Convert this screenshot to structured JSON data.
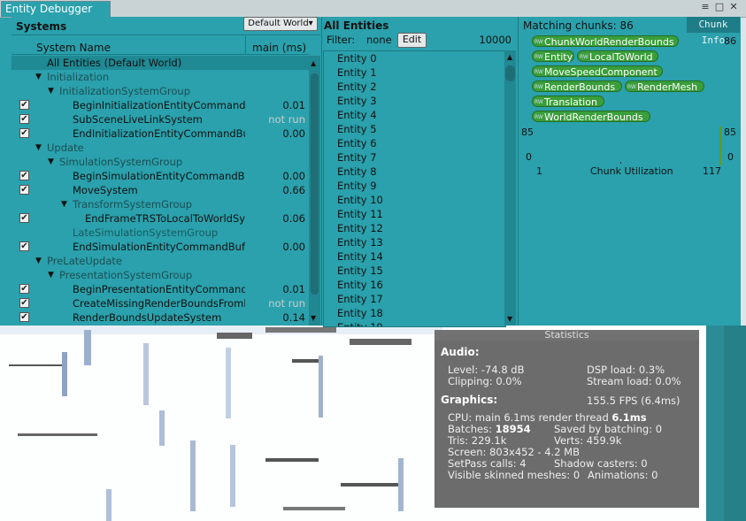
{
  "window": {
    "tab_title": "Entity Debugger"
  },
  "systems": {
    "title": "Systems",
    "world_button": "Default World▾",
    "col_name": "System Name",
    "col_main": "main (ms)",
    "rows": [
      {
        "name": "All Entities (Default World)",
        "indent": 40,
        "check": false,
        "tri": "",
        "val": "",
        "sel": true
      },
      {
        "name": "Initialization",
        "indent": 40,
        "check": false,
        "tri": "▼",
        "val": "",
        "grp": true
      },
      {
        "name": "InitializationSystemGroup",
        "indent": 54,
        "check": false,
        "tri": "▼",
        "val": "",
        "grp": true
      },
      {
        "name": "BeginInitializationEntityCommandB",
        "indent": 69,
        "check": true,
        "tri": "",
        "val": "0.01"
      },
      {
        "name": "SubSceneLiveLinkSystem",
        "indent": 69,
        "check": true,
        "tri": "",
        "val": "not run",
        "nr": true
      },
      {
        "name": "EndInitializationEntityCommandBu",
        "indent": 69,
        "check": true,
        "tri": "",
        "val": "0.00"
      },
      {
        "name": "Update",
        "indent": 40,
        "check": false,
        "tri": "▼",
        "val": "",
        "grp": true
      },
      {
        "name": "SimulationSystemGroup",
        "indent": 54,
        "check": false,
        "tri": "▼",
        "val": "",
        "grp": true
      },
      {
        "name": "BeginSimulationEntityCommandBu",
        "indent": 69,
        "check": true,
        "tri": "",
        "val": "0.00"
      },
      {
        "name": "MoveSystem",
        "indent": 69,
        "check": true,
        "tri": "",
        "val": "0.66"
      },
      {
        "name": "TransformSystemGroup",
        "indent": 69,
        "check": false,
        "tri": "▼",
        "val": "",
        "grp": true
      },
      {
        "name": "EndFrameTRSToLocalToWorldSy",
        "indent": 83,
        "check": true,
        "tri": "",
        "val": "0.06"
      },
      {
        "name": "LateSimulationSystemGroup",
        "indent": 69,
        "check": false,
        "tri": "",
        "val": "",
        "dim": true
      },
      {
        "name": "EndSimulationEntityCommandBuff",
        "indent": 69,
        "check": true,
        "tri": "",
        "val": "0.00"
      },
      {
        "name": "PreLateUpdate",
        "indent": 40,
        "check": false,
        "tri": "▼",
        "val": "",
        "grp": true
      },
      {
        "name": "PresentationSystemGroup",
        "indent": 54,
        "check": false,
        "tri": "▼",
        "val": "",
        "grp": true
      },
      {
        "name": "BeginPresentationEntityCommand",
        "indent": 69,
        "check": true,
        "tri": "",
        "val": "0.01"
      },
      {
        "name": "CreateMissingRenderBoundsFroml",
        "indent": 69,
        "check": true,
        "tri": "",
        "val": "not run",
        "nr": true
      },
      {
        "name": "RenderBoundsUpdateSystem",
        "indent": 69,
        "check": true,
        "tri": "",
        "val": "0.14"
      }
    ]
  },
  "entities": {
    "title": "All Entities",
    "filter_label": "Filter:",
    "filter_value": "none",
    "edit_button": "Edit",
    "count": "10000",
    "items": [
      "Entity 0",
      "Entity 1",
      "Entity 2",
      "Entity 3",
      "Entity 4",
      "Entity 5",
      "Entity 6",
      "Entity 7",
      "Entity 8",
      "Entity 9",
      "Entity 10",
      "Entity 11",
      "Entity 12",
      "Entity 13",
      "Entity 14",
      "Entity 15",
      "Entity 16",
      "Entity 17",
      "Entity 18",
      "Entity 19"
    ]
  },
  "chunks": {
    "matching_label": "Matching chunks: 86",
    "chunk_info_button": "Chunk Info",
    "count": "86",
    "tag_lines": [
      [
        "ChunkWorldRenderBounds"
      ],
      [
        "Entity",
        "LocalToWorld"
      ],
      [
        "MoveSpeedComponent"
      ],
      [
        "RenderBounds",
        "RenderMesh"
      ],
      [
        "Translation"
      ],
      [
        "WorldRenderBounds"
      ]
    ],
    "graph": {
      "left_top": "85",
      "left_bottom": "0",
      "right_top": "85",
      "right_bottom": "0",
      "x_min": "1",
      "x_max": "117",
      "x_label": "Chunk Utilization"
    }
  },
  "stats": {
    "title": "Statistics",
    "audio_heading": "Audio:",
    "level": "Level: -74.8 dB",
    "clipping": "Clipping: 0.0%",
    "dsp": "DSP load: 0.3%",
    "stream": "Stream load: 0.0%",
    "graphics_heading": "Graphics:",
    "fps": "155.5 FPS (6.4ms)",
    "cpu_prefix": "CPU: main ",
    "cpu_main": "6.1ms",
    "cpu_mid": "  render thread ",
    "cpu_render": "6.1ms",
    "batches_prefix": "Batches: ",
    "batches": "18954",
    "saved": "Saved by batching: 0",
    "tris": "Tris: 229.1k",
    "verts": "Verts: 459.9k",
    "screen": "Screen: 803x452 - 4.2 MB",
    "setpass": "SetPass calls: 4",
    "shadow": "Shadow casters: 0",
    "skinned": "Visible skinned meshes: 0",
    "animations": "Animations: 0"
  }
}
